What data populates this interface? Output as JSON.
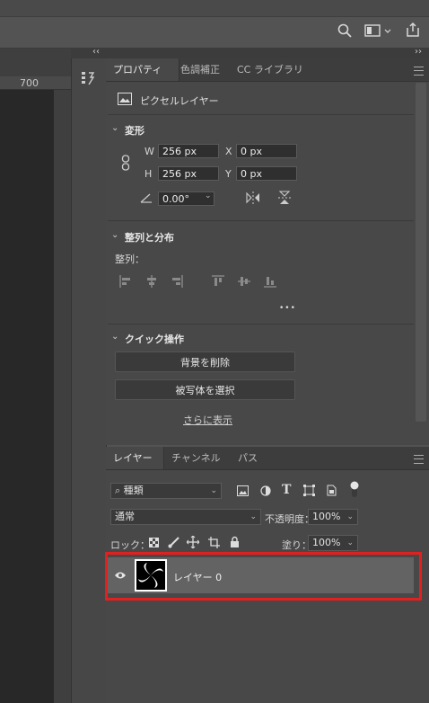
{
  "ruler": {
    "label": "700"
  },
  "collapse": {
    "left": "‹‹",
    "right": "››"
  },
  "properties_tabs": [
    "プロパティ",
    "色調補正",
    "CC ライブラリ"
  ],
  "layer_type": "ピクセルレイヤー",
  "transform": {
    "title": "変形",
    "w_label": "W",
    "w_value": "256 px",
    "h_label": "H",
    "h_value": "256 px",
    "x_label": "X",
    "x_value": "0 px",
    "y_label": "Y",
    "y_value": "0 px",
    "angle": "0.00°"
  },
  "align": {
    "title": "整列と分布",
    "label": "整列：",
    "more": "•••"
  },
  "quick": {
    "title": "クイック操作",
    "remove_bg": "背景を削除",
    "select_subject": "被写体を選択",
    "more_link": "さらに表示"
  },
  "layers_tabs": [
    "レイヤー",
    "チャンネル",
    "パス"
  ],
  "filter": {
    "kind": "種類"
  },
  "blend": {
    "mode": "通常",
    "opacity_label": "不透明度：",
    "opacity": "100%",
    "fill_label": "塗り：",
    "fill": "100%"
  },
  "lock_label": "ロック：",
  "layer": {
    "name": "レイヤー 0"
  },
  "colors": {
    "highlight": "#e32020",
    "panel": "#484848",
    "selected_row": "#636363"
  }
}
